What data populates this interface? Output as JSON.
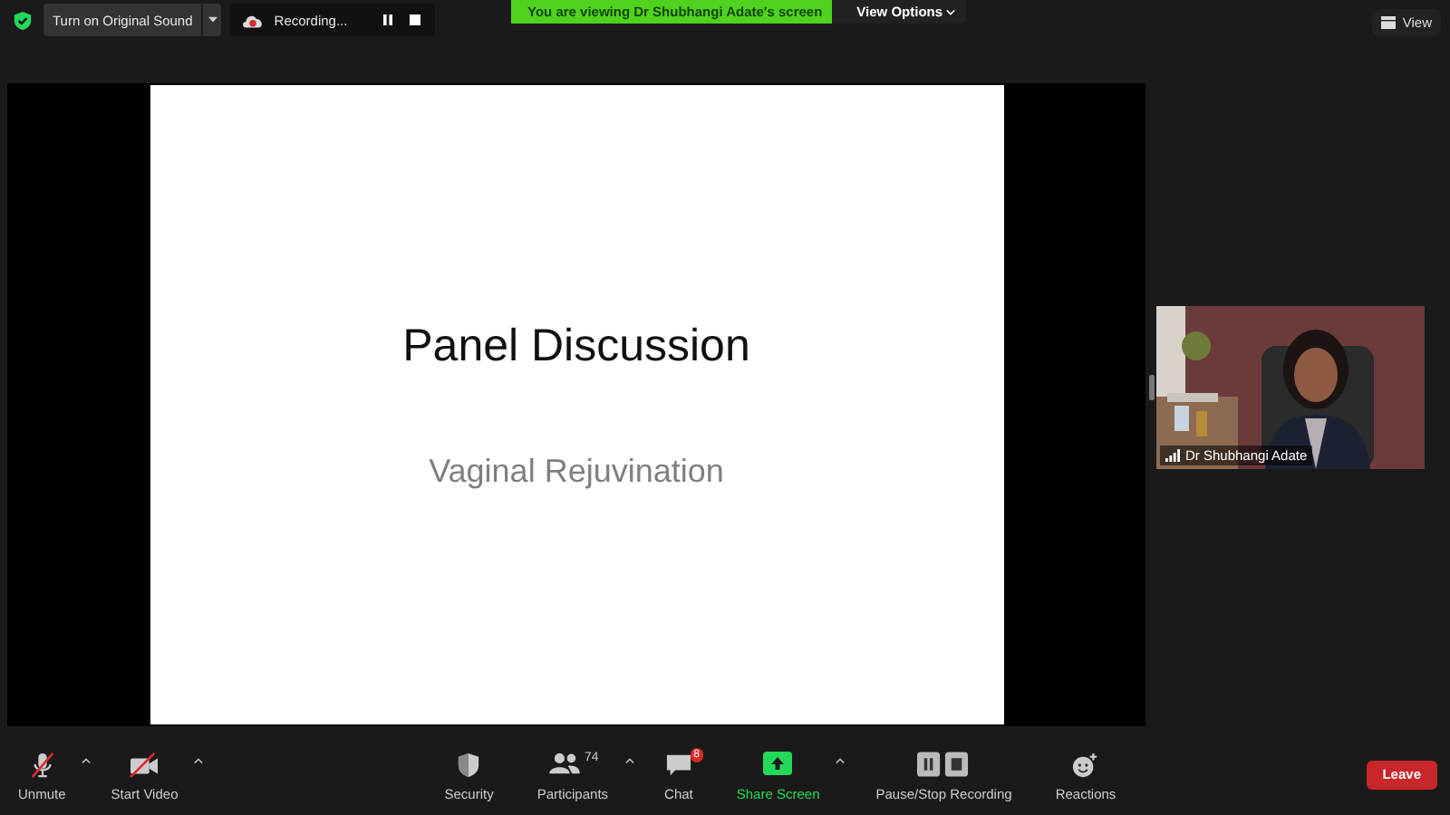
{
  "top_bar": {
    "original_sound_button": "Turn on Original Sound",
    "recording_label": "Recording...",
    "viewing_banner": "You are viewing Dr Shubhangi Adate's screen",
    "view_options": "View Options",
    "view_button": "View"
  },
  "slide": {
    "title": "Panel Discussion",
    "subtitle": "Vaginal Rejuvination"
  },
  "participant_video": {
    "kind": "picture",
    "name": "Dr Shubhangi Adate"
  },
  "toolbar": {
    "left": [
      {
        "kind": "mic",
        "label": "Unmute",
        "muted": true,
        "menu": true
      },
      {
        "kind": "video",
        "label": "Start Video",
        "muted": true,
        "menu": true
      }
    ],
    "center": [
      {
        "kind": "security",
        "label": "Security",
        "menu": false
      },
      {
        "kind": "participants",
        "label": "Participants",
        "count": "74",
        "menu": true
      },
      {
        "kind": "chat",
        "label": "Chat",
        "badge": "8",
        "menu": false
      },
      {
        "kind": "share",
        "label": "Share Screen",
        "menu": true
      },
      {
        "kind": "record",
        "label": "Pause/Stop Recording",
        "menu": false
      },
      {
        "kind": "reactions",
        "label": "Reactions",
        "menu": false
      }
    ],
    "leave": "Leave"
  }
}
